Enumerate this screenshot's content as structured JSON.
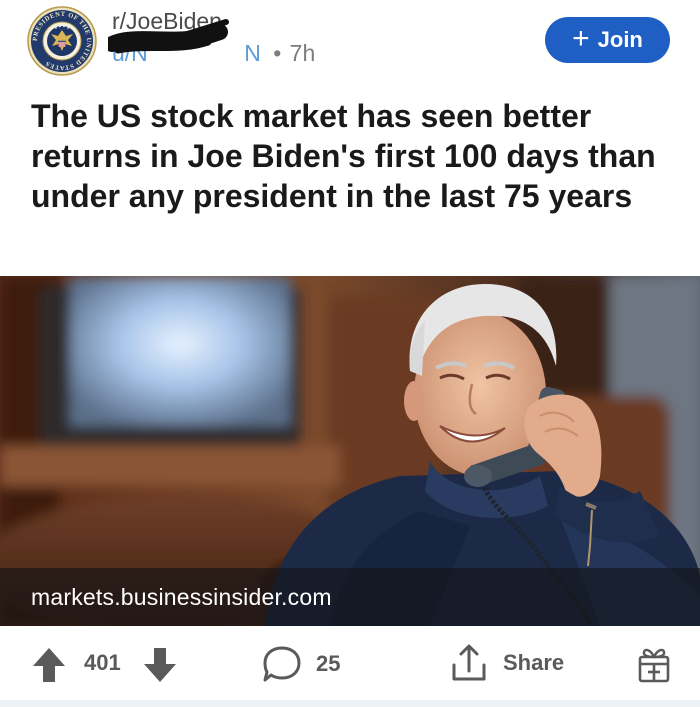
{
  "post": {
    "subreddit": "r/JoeBiden",
    "author_visible": "u/N",
    "author_tail": "N",
    "separator": "•",
    "age": "7h",
    "title": "The US stock market has seen better returns in Joe Biden's first 100 days than under any president in the last 75 years"
  },
  "avatar": {
    "icon": "presidential-seal-icon",
    "seal_text": "PRESIDENT OF THE UNITED STATES"
  },
  "join_button": {
    "icon": "plus-icon",
    "label": "Join"
  },
  "link": {
    "domain": "markets.businessinsider.com"
  },
  "actions": {
    "upvote_icon": "arrow-up-icon",
    "downvote_icon": "arrow-down-icon",
    "vote_count": "401",
    "comment_icon": "speech-bubble-icon",
    "comment_count": "25",
    "share_icon": "share-icon",
    "share_label": "Share",
    "award_icon": "gift-icon"
  },
  "colors": {
    "join_blue": "#1f5fc4",
    "username_blue": "#5e9bd6",
    "action_grey": "#5a5a5a"
  }
}
